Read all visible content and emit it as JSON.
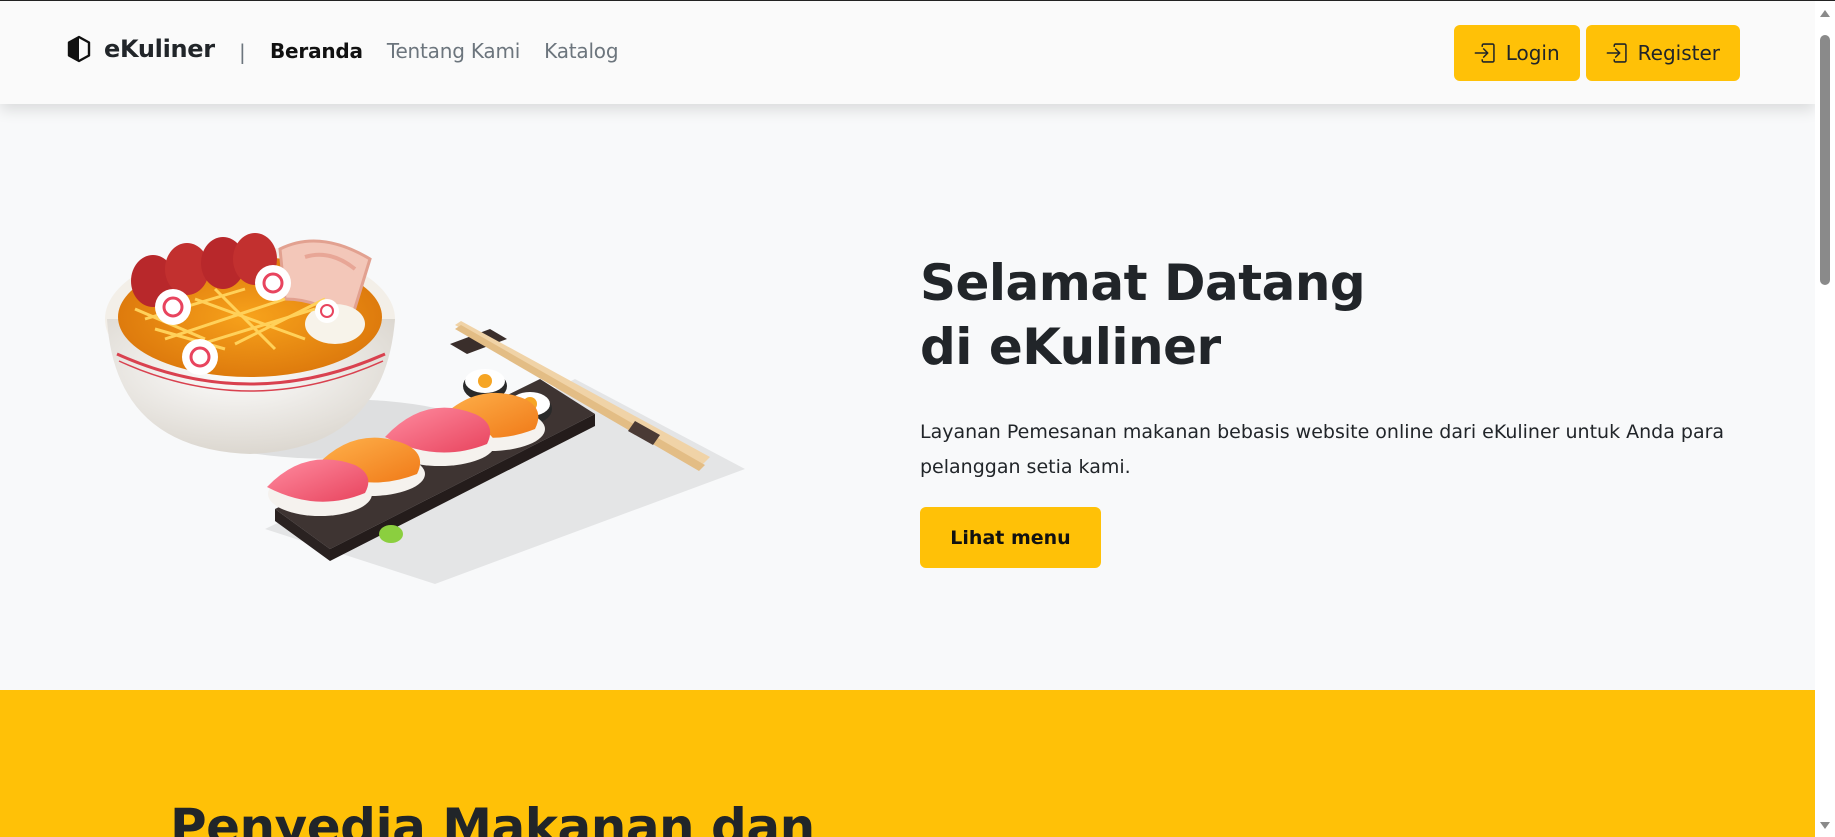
{
  "nav": {
    "brand": "eKuliner",
    "divider": "|",
    "links": [
      {
        "label": "Beranda",
        "active": true
      },
      {
        "label": "Tentang Kami",
        "active": false
      },
      {
        "label": "Katalog",
        "active": false
      }
    ],
    "login_label": "Login",
    "register_label": "Register"
  },
  "hero": {
    "title_line1": "Selamat Datang",
    "title_line2": "di eKuliner",
    "description": "Layanan Pemesanan makanan bebasis website online dari eKuliner untuk Anda para pelanggan setia kami.",
    "cta_label": "Lihat menu"
  },
  "section2": {
    "title": "Penyedia Makanan dan"
  },
  "colors": {
    "accent": "#ffc107",
    "text": "#212529",
    "muted": "#6c757d",
    "background": "#f8f9fa"
  },
  "icons": {
    "brand": "hexagon-half-icon",
    "login": "box-arrow-in-right-icon",
    "register": "box-arrow-in-right-icon"
  }
}
